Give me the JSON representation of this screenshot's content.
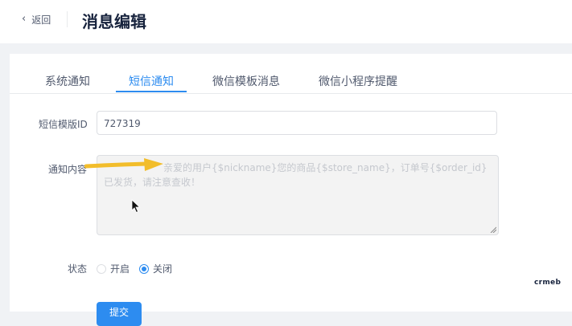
{
  "header": {
    "back_label": "返回",
    "title": "消息编辑"
  },
  "tabs": [
    {
      "label": "系统通知",
      "active": false
    },
    {
      "label": "短信通知",
      "active": true
    },
    {
      "label": "微信模板消息",
      "active": false
    },
    {
      "label": "微信小程序提醒",
      "active": false
    }
  ],
  "form": {
    "template_id_label": "短信模版ID",
    "template_id_value": "727319",
    "content_label": "通知内容",
    "content_value": "亲爱的用户{$nickname}您的商品{$store_name}，订单号{$order_id}已发货，请注意查收！",
    "status_label": "状态",
    "status_options": [
      {
        "label": "开启",
        "checked": false
      },
      {
        "label": "关闭",
        "checked": true
      }
    ],
    "submit_label": "提交"
  },
  "watermark": "crmeb",
  "colors": {
    "accent": "#2d8cf0",
    "arrow": "#f2bd2b"
  }
}
